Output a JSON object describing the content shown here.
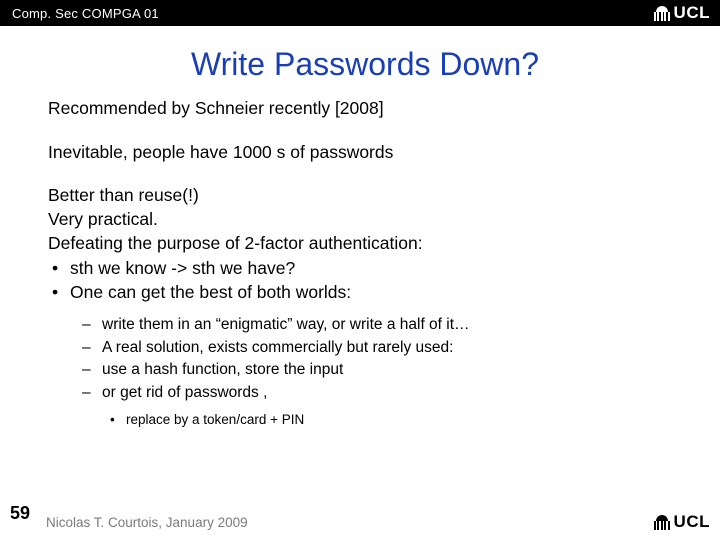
{
  "header": {
    "course": "Comp. Sec COMPGA 01",
    "logo_text": "UCL"
  },
  "title": "Write Passwords Down?",
  "body": {
    "p1": "Recommended by Schneier recently [2008]",
    "p2": "Inevitable, people have 1000 s of passwords",
    "l1": "Better than reuse(!)",
    "l2": "Very practical.",
    "l3": "Defeating the purpose of 2-factor authentication:",
    "bullets": {
      "b1": "sth we know -> sth we have?",
      "b2": "One can get the best of both worlds:"
    },
    "sub": {
      "s1": "write them in an “enigmatic” way, or write a half of it…",
      "s2": "A real solution, exists commercially but rarely used:",
      "s3": "use a hash function, store the input",
      "s4": "or get rid of passwords        ,"
    },
    "subsub": {
      "ss1": "replace by a token/card + PIN"
    }
  },
  "footer": {
    "page": "59",
    "author": "Nicolas T. Courtois, January 2009",
    "logo_text": "UCL"
  }
}
